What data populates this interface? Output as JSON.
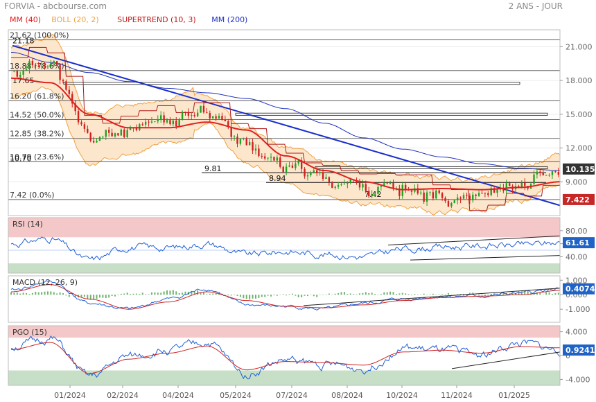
{
  "header": {
    "left": "FORVIA - abcbourse.com",
    "right": "2 ANS - JOUR"
  },
  "colors": {
    "mm40": "#e02020",
    "boll": "#f0a040",
    "boll_fill": "#fbe3c4",
    "supertrend": "#b01818",
    "mm200": "#2030c0",
    "trendline": "#1a2ecc",
    "price_up": "#22a022",
    "price_down": "#d02020",
    "overbought_zone": "#f4c8c8",
    "oversold_zone": "#c6dfc6",
    "rsi_line": "#1f5fd6",
    "macd_line": "#1f5fd6",
    "signal_line": "#d02020",
    "histogram": "#4aa04a",
    "tag_blue": "#1f63c6",
    "tag_red": "#c62828",
    "tag_dark": "#333333"
  },
  "chart_data": [
    {
      "type": "line",
      "panel": "price",
      "legend": [
        {
          "label": "MM (40)",
          "color": "#e02020"
        },
        {
          "label": "BOLL (20, 2)",
          "color": "#f0a040"
        },
        {
          "label": "SUPERTREND (10, 3)",
          "color": "#c01818"
        },
        {
          "label": "MM (200)",
          "color": "#2030c0"
        }
      ],
      "ylim": [
        6.0,
        22.5
      ],
      "yticks": [
        {
          "value": 21.0,
          "label": "21.000"
        },
        {
          "value": 18.0,
          "label": "18.000"
        },
        {
          "value": 15.0,
          "label": "15.000"
        },
        {
          "value": 12.0,
          "label": "12.000"
        },
        {
          "value": 9.0,
          "label": "9.000"
        }
      ],
      "x_axis_labels": [
        "01/2024",
        "02/2024",
        "04/2024",
        "05/2024",
        "07/2024",
        "08/2024",
        "10/2024",
        "11/2024",
        "01/2025"
      ],
      "fib_levels": [
        {
          "value": 21.62,
          "label": "21.62 (100.0%)"
        },
        {
          "value": 18.88,
          "label": "18.88 (78.6%)"
        },
        {
          "value": 16.2,
          "label": "16.20 (61.8%)"
        },
        {
          "value": 14.52,
          "label": "14.52 (50.0%)"
        },
        {
          "value": 12.85,
          "label": "12.85 (38.2%)"
        },
        {
          "value": 10.79,
          "label": "10.79 (23.6%)"
        },
        {
          "value": 7.42,
          "label": "7.42 (0.0%)"
        }
      ],
      "level_labels": [
        {
          "value": 21.18,
          "label": "21.18"
        },
        {
          "value": 17.65,
          "label": "17.65"
        },
        {
          "value": 10.7,
          "label": "10.70"
        },
        {
          "value": 9.81,
          "label": "9.81"
        },
        {
          "value": 8.94,
          "label": "8.94"
        },
        {
          "value": 7.42,
          "label": "7.42"
        }
      ],
      "value_tags": [
        {
          "value": 10.135,
          "label": "10.135",
          "color": "#333333"
        },
        {
          "value": 7.422,
          "label": "7.422",
          "color": "#c62828"
        }
      ],
      "key_points_x": [
        "2023-12",
        "2024-01",
        "2024-02",
        "2024-03",
        "2024-04",
        "2024-05",
        "2024-06",
        "2024-07",
        "2024-08",
        "2024-09",
        "2024-10",
        "2024-11",
        "2024-12",
        "2025-01",
        "2025-02"
      ],
      "series": [
        {
          "name": "close",
          "values": [
            18.7,
            19.6,
            12.8,
            13.6,
            14.4,
            15.4,
            12.2,
            10.5,
            9.3,
            8.6,
            8.2,
            7.8,
            7.9,
            8.8,
            10.1
          ]
        },
        {
          "name": "MM (40)",
          "values": [
            18.2,
            17.8,
            15.0,
            13.8,
            13.8,
            14.3,
            13.6,
            11.3,
            10.0,
            9.0,
            8.3,
            8.4,
            8.3,
            8.5,
            9.0
          ]
        },
        {
          "name": "MM (200)",
          "values": [
            20.5,
            19.6,
            18.7,
            17.9,
            17.3,
            16.9,
            16.4,
            15.5,
            14.2,
            12.9,
            11.9,
            11.2,
            10.6,
            10.2,
            10.0
          ]
        }
      ],
      "trendline": [
        {
          "x": "2023-12",
          "y": 21.1
        },
        {
          "x": "2025-02",
          "y": 6.9
        }
      ]
    },
    {
      "type": "line",
      "panel": "rsi",
      "title": "RSI (14)",
      "ylim": [
        15,
        100
      ],
      "yticks": [
        {
          "value": 80,
          "label": "80.00"
        },
        {
          "value": 60,
          "label": "60.00"
        },
        {
          "value": 40,
          "label": "40.00"
        }
      ],
      "zones": {
        "overbought": 70,
        "oversold": 30
      },
      "value_tag": {
        "value": 61.61,
        "label": "61.61"
      },
      "series": [
        {
          "name": "RSI",
          "values": [
            60,
            68,
            35,
            55,
            54,
            60,
            43,
            48,
            44,
            40,
            52,
            55,
            57,
            58,
            62
          ]
        }
      ]
    },
    {
      "type": "line",
      "panel": "macd",
      "title": "MACD (12, 26, 9)",
      "ylim": [
        -1.9,
        1.3
      ],
      "yticks": [
        {
          "value": 1.0,
          "label": "1.000"
        },
        {
          "value": 0.0,
          "label": "0.000"
        },
        {
          "value": -1.0,
          "label": "-1.000"
        }
      ],
      "value_tag": {
        "value": 0.4074,
        "label": "0.4074"
      },
      "series": [
        {
          "name": "MACD",
          "values": [
            0.3,
            0.9,
            -0.6,
            -1.0,
            -0.3,
            0.4,
            -0.7,
            -0.8,
            -1.0,
            -0.6,
            -0.3,
            -0.1,
            -0.1,
            0.1,
            0.4
          ]
        },
        {
          "name": "signal",
          "values": [
            0.2,
            0.7,
            -0.3,
            -1.0,
            -0.5,
            0.2,
            -0.4,
            -0.8,
            -0.9,
            -0.7,
            -0.4,
            -0.2,
            -0.1,
            0.0,
            0.3
          ]
        }
      ]
    },
    {
      "type": "line",
      "panel": "pgo",
      "title": "PGO (15)",
      "ylim": [
        -5.0,
        5.0
      ],
      "yticks": [
        {
          "value": 4.0,
          "label": "4.000"
        },
        {
          "value": 0.0,
          "label": "0"
        },
        {
          "value": -4.0,
          "label": "-4.000"
        }
      ],
      "zones": {
        "upper": 3.0,
        "lower": -2.5
      },
      "value_tag": {
        "value": 0.9241,
        "label": "0.9241"
      },
      "series": [
        {
          "name": "PGO",
          "values": [
            1.5,
            2.8,
            -3.6,
            -0.2,
            0.8,
            2.2,
            -3.0,
            -0.8,
            -1.5,
            -2.2,
            1.2,
            0.8,
            0.2,
            2.0,
            0.9
          ]
        },
        {
          "name": "signal",
          "values": [
            1.0,
            2.2,
            -3.0,
            -0.6,
            0.4,
            1.6,
            -2.4,
            -1.0,
            -1.2,
            -1.6,
            0.6,
            0.9,
            0.4,
            1.5,
            1.3
          ]
        }
      ]
    }
  ]
}
